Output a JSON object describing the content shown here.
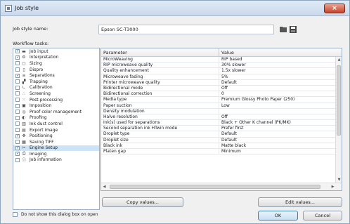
{
  "window": {
    "title": "Job style",
    "close_label": "×"
  },
  "job_style": {
    "label": "Job style name:",
    "value": "Epson SC-T3000"
  },
  "workflow": {
    "label": "Workflow tasks:",
    "tasks": [
      {
        "label": "Job input",
        "checked": true,
        "icon": "monitor-icon"
      },
      {
        "label": "Interpretation",
        "checked": true,
        "icon": "gear-icon"
      },
      {
        "label": "Sizing",
        "checked": false,
        "icon": "sizing-icon"
      },
      {
        "label": "Dispro",
        "checked": false,
        "icon": "page-icon"
      },
      {
        "label": "Separations",
        "checked": true,
        "icon": "separations-icon"
      },
      {
        "label": "Trapping",
        "checked": false,
        "icon": "trapping-icon"
      },
      {
        "label": "Calibration",
        "checked": false,
        "icon": "calibration-icon"
      },
      {
        "label": "Screening",
        "checked": false,
        "icon": "screening-icon"
      },
      {
        "label": "Post-processing",
        "checked": false,
        "icon": "dots-icon"
      },
      {
        "label": "Imposition",
        "checked": false,
        "icon": "book-icon"
      },
      {
        "label": "Proof color management",
        "checked": false,
        "icon": "color-icon"
      },
      {
        "label": "Proofing",
        "checked": false,
        "icon": "proof-icon"
      },
      {
        "label": "Ink duct control",
        "checked": false,
        "icon": "bars-icon"
      },
      {
        "label": "Export image",
        "checked": false,
        "icon": "export-icon"
      },
      {
        "label": "Positioning",
        "checked": true,
        "icon": "position-icon"
      },
      {
        "label": "Saving TIFF",
        "checked": false,
        "icon": "disk-icon"
      },
      {
        "label": "Engine Setup",
        "checked": true,
        "icon": "tools-icon",
        "selected": true
      },
      {
        "label": "Imaging",
        "checked": true,
        "icon": "printer-icon"
      },
      {
        "label": "Job information",
        "checked": false,
        "icon": "info-icon"
      }
    ]
  },
  "grid": {
    "header_param": "Parameter",
    "header_value": "Value",
    "rows": [
      {
        "param": "MicroWeaving",
        "value": "RIP based"
      },
      {
        "param": "RIP microweave quality",
        "value": "30% slower"
      },
      {
        "param": "Quality enhancement",
        "value": "1.5x slower"
      },
      {
        "param": "Microweave fading",
        "value": "5%"
      },
      {
        "param": "Printer microweave quality",
        "value": "Default"
      },
      {
        "param": "Bidirectional mode",
        "value": "Off"
      },
      {
        "param": "Bidirectional correction",
        "value": "0"
      },
      {
        "param": "Media type",
        "value": "Premium Glossy Photo Paper (250)"
      },
      {
        "param": "Paper suction",
        "value": "Low"
      },
      {
        "param": "Density modulation",
        "value": ""
      },
      {
        "param": "Halve resolution",
        "value": "Off"
      },
      {
        "param": "Ink(s) used for separations",
        "value": "Black + Other K channel (PK/MK)"
      },
      {
        "param": "Second separation ink HTwin mode",
        "value": "Prefer first"
      },
      {
        "param": "Droplet type",
        "value": "Default"
      },
      {
        "param": "Droplet size",
        "value": "Default"
      },
      {
        "param": "Black ink",
        "value": "Matte black"
      },
      {
        "param": "Platen gap",
        "value": "Minimum"
      }
    ]
  },
  "buttons": {
    "copy": "Copy values...",
    "edit": "Edit values...",
    "ok": "OK",
    "cancel": "Cancel"
  },
  "footer": {
    "dont_show": "Do not show this dialog box on open"
  }
}
